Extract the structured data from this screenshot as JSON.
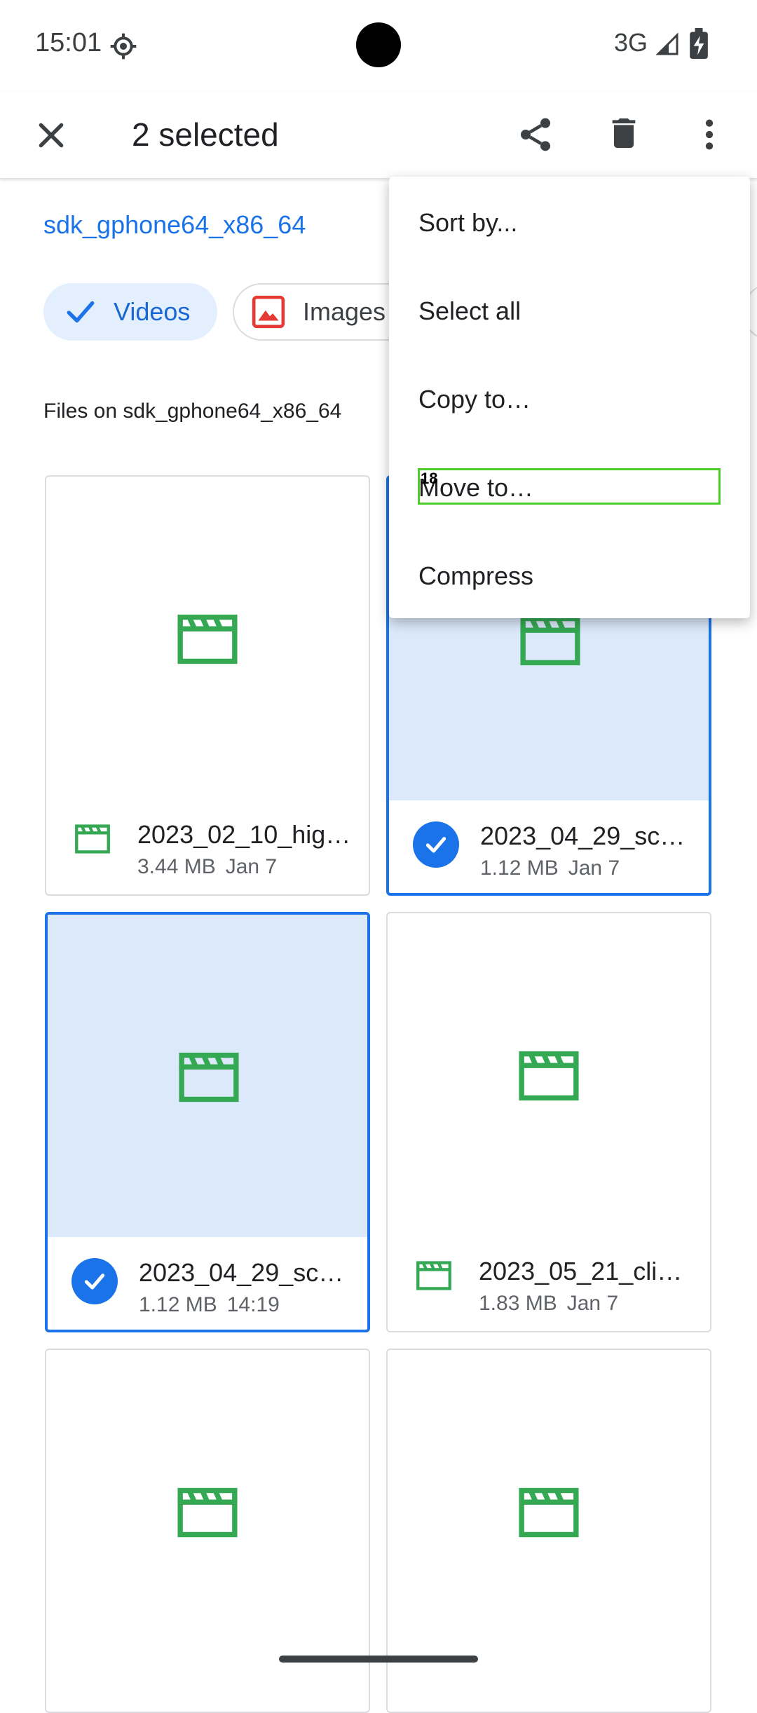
{
  "status": {
    "time": "15:01",
    "network": "3G"
  },
  "toolbar": {
    "title": "2 selected"
  },
  "storage_link": "sdk_gphone64_x86_64",
  "chips": {
    "videos": "Videos",
    "images": "Images"
  },
  "section_title": "Files on sdk_gphone64_x86_64",
  "files": [
    {
      "name": "2023_02_10_hig…",
      "size": "3.44 MB",
      "date": "Jan 7",
      "selected": false
    },
    {
      "name": "2023_04_29_sc…",
      "size": "1.12 MB",
      "date": "Jan 7",
      "selected": true
    },
    {
      "name": "2023_04_29_sc…",
      "size": "1.12 MB",
      "date": "14:19",
      "selected": true
    },
    {
      "name": "2023_05_21_cli…",
      "size": "1.83 MB",
      "date": "Jan 7",
      "selected": false
    }
  ],
  "menu": {
    "items": [
      "Sort by...",
      "Select all",
      "Copy to…",
      "Move to…",
      "Compress"
    ]
  },
  "highlight_label": "18",
  "colors": {
    "accent": "#1a73e8",
    "video_icon": "#34a853",
    "image_icon": "#e53935"
  }
}
